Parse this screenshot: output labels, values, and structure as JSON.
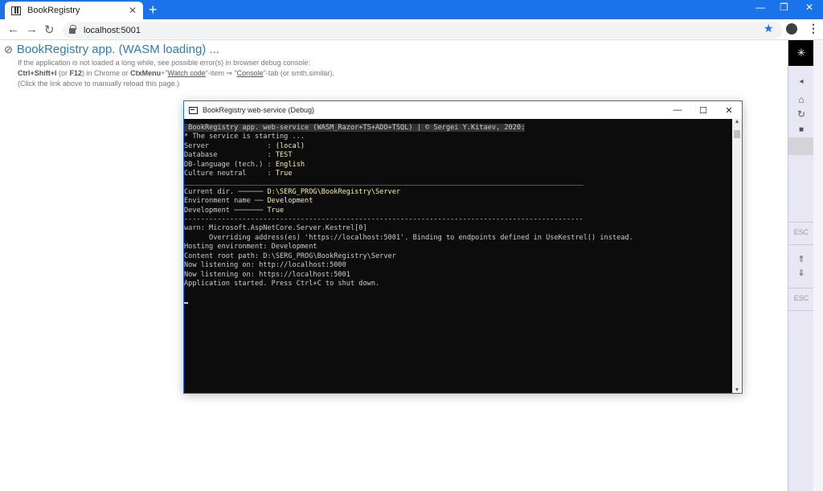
{
  "browser": {
    "tab_title": "BookRegistry",
    "tab_close": "✕",
    "new_tab": "+",
    "url": "localhost:5001",
    "window_controls": [
      "—",
      "❐",
      "✕"
    ]
  },
  "page": {
    "title_link": "BookRegistry app. (WASM loading) ...",
    "info_line1": "If the application is not loaded a long while, see possible error(s) in browser debug console:",
    "info_line2_parts": {
      "kbd1": "Ctrl+Shift+I",
      "or": " (or ",
      "kbd2": "F12",
      "mid": ") in Chrome or ",
      "kbd3": "CtxMenu",
      "plus": "+\"",
      "watch": "Watch code",
      "item": "\"-item ⇒ \"",
      "console": "Console",
      "tail": "\"-tab (or smth.similar)."
    },
    "info_line3": "(Click the link above to manually reload this page.)"
  },
  "sidebar": {
    "esc1": "ESC",
    "esc2": "ESC"
  },
  "console_window": {
    "title": "BookRegistry web-service (Debug)",
    "header": " BookRegistry app. web-service (WASM_Razor+TS+ADO+TSQL) | © Sergei Y.Kitaev, 2020:",
    "starting": "* The service is starting ...",
    "rows": [
      {
        "label": "Server              : ",
        "value": "(local)"
      },
      {
        "label": "Database            : ",
        "value": "TEST"
      },
      {
        "label": "DB-language (tech.) : ",
        "value": "English"
      },
      {
        "label": "Culture neutral     : ",
        "value": "True"
      }
    ],
    "sep1": "________________________________________________________________________________________________",
    "env": [
      {
        "label": "Current dir. ────── ",
        "value": "D:\\SERG_PROG\\BookRegistry\\Server"
      },
      {
        "label": "Environment name ── ",
        "value": "Development"
      },
      {
        "label": "Development ─────── ",
        "value": "True"
      }
    ],
    "sep2": "------------------------------------------------------------------------------------------------",
    "warn": "warn",
    "warn_rest": ": Microsoft.AspNetCore.Server.Kestrel[0]",
    "log": [
      "      Overriding address(es) 'https://localhost:5001'. Binding to endpoints defined in UseKestrel() instead.",
      "Hosting environment: Development",
      "Content root path: D:\\SERG_PROG\\BookRegistry\\Server",
      "Now listening on: http://localhost:5000",
      "Now listening on: https://localhost:5001",
      "Application started. Press Ctrl+C to shut down."
    ]
  }
}
